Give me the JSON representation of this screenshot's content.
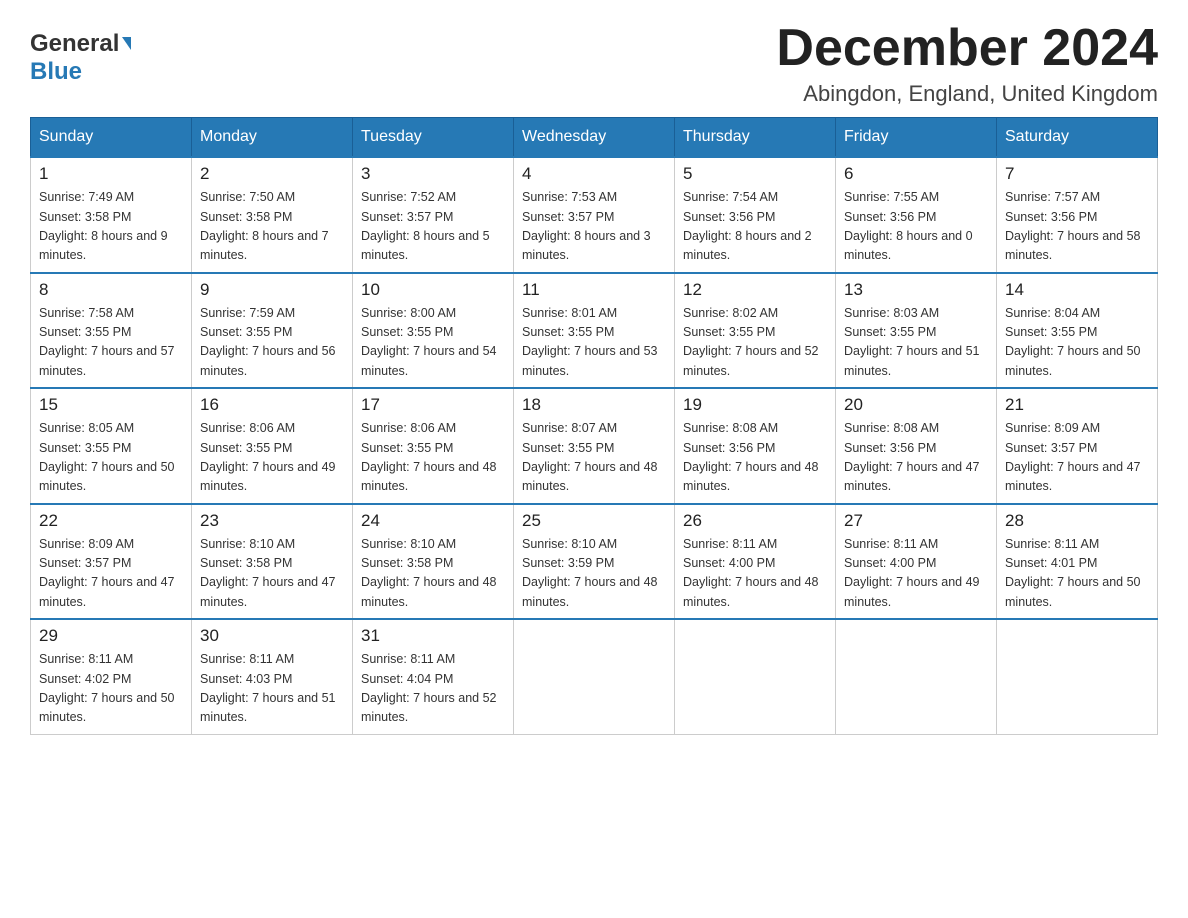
{
  "header": {
    "logo_general": "General",
    "logo_blue": "Blue",
    "month_title": "December 2024",
    "location": "Abingdon, England, United Kingdom"
  },
  "weekdays": [
    "Sunday",
    "Monday",
    "Tuesday",
    "Wednesday",
    "Thursday",
    "Friday",
    "Saturday"
  ],
  "weeks": [
    [
      {
        "day": "1",
        "sunrise": "7:49 AM",
        "sunset": "3:58 PM",
        "daylight": "8 hours and 9 minutes."
      },
      {
        "day": "2",
        "sunrise": "7:50 AM",
        "sunset": "3:58 PM",
        "daylight": "8 hours and 7 minutes."
      },
      {
        "day": "3",
        "sunrise": "7:52 AM",
        "sunset": "3:57 PM",
        "daylight": "8 hours and 5 minutes."
      },
      {
        "day": "4",
        "sunrise": "7:53 AM",
        "sunset": "3:57 PM",
        "daylight": "8 hours and 3 minutes."
      },
      {
        "day": "5",
        "sunrise": "7:54 AM",
        "sunset": "3:56 PM",
        "daylight": "8 hours and 2 minutes."
      },
      {
        "day": "6",
        "sunrise": "7:55 AM",
        "sunset": "3:56 PM",
        "daylight": "8 hours and 0 minutes."
      },
      {
        "day": "7",
        "sunrise": "7:57 AM",
        "sunset": "3:56 PM",
        "daylight": "7 hours and 58 minutes."
      }
    ],
    [
      {
        "day": "8",
        "sunrise": "7:58 AM",
        "sunset": "3:55 PM",
        "daylight": "7 hours and 57 minutes."
      },
      {
        "day": "9",
        "sunrise": "7:59 AM",
        "sunset": "3:55 PM",
        "daylight": "7 hours and 56 minutes."
      },
      {
        "day": "10",
        "sunrise": "8:00 AM",
        "sunset": "3:55 PM",
        "daylight": "7 hours and 54 minutes."
      },
      {
        "day": "11",
        "sunrise": "8:01 AM",
        "sunset": "3:55 PM",
        "daylight": "7 hours and 53 minutes."
      },
      {
        "day": "12",
        "sunrise": "8:02 AM",
        "sunset": "3:55 PM",
        "daylight": "7 hours and 52 minutes."
      },
      {
        "day": "13",
        "sunrise": "8:03 AM",
        "sunset": "3:55 PM",
        "daylight": "7 hours and 51 minutes."
      },
      {
        "day": "14",
        "sunrise": "8:04 AM",
        "sunset": "3:55 PM",
        "daylight": "7 hours and 50 minutes."
      }
    ],
    [
      {
        "day": "15",
        "sunrise": "8:05 AM",
        "sunset": "3:55 PM",
        "daylight": "7 hours and 50 minutes."
      },
      {
        "day": "16",
        "sunrise": "8:06 AM",
        "sunset": "3:55 PM",
        "daylight": "7 hours and 49 minutes."
      },
      {
        "day": "17",
        "sunrise": "8:06 AM",
        "sunset": "3:55 PM",
        "daylight": "7 hours and 48 minutes."
      },
      {
        "day": "18",
        "sunrise": "8:07 AM",
        "sunset": "3:55 PM",
        "daylight": "7 hours and 48 minutes."
      },
      {
        "day": "19",
        "sunrise": "8:08 AM",
        "sunset": "3:56 PM",
        "daylight": "7 hours and 48 minutes."
      },
      {
        "day": "20",
        "sunrise": "8:08 AM",
        "sunset": "3:56 PM",
        "daylight": "7 hours and 47 minutes."
      },
      {
        "day": "21",
        "sunrise": "8:09 AM",
        "sunset": "3:57 PM",
        "daylight": "7 hours and 47 minutes."
      }
    ],
    [
      {
        "day": "22",
        "sunrise": "8:09 AM",
        "sunset": "3:57 PM",
        "daylight": "7 hours and 47 minutes."
      },
      {
        "day": "23",
        "sunrise": "8:10 AM",
        "sunset": "3:58 PM",
        "daylight": "7 hours and 47 minutes."
      },
      {
        "day": "24",
        "sunrise": "8:10 AM",
        "sunset": "3:58 PM",
        "daylight": "7 hours and 48 minutes."
      },
      {
        "day": "25",
        "sunrise": "8:10 AM",
        "sunset": "3:59 PM",
        "daylight": "7 hours and 48 minutes."
      },
      {
        "day": "26",
        "sunrise": "8:11 AM",
        "sunset": "4:00 PM",
        "daylight": "7 hours and 48 minutes."
      },
      {
        "day": "27",
        "sunrise": "8:11 AM",
        "sunset": "4:00 PM",
        "daylight": "7 hours and 49 minutes."
      },
      {
        "day": "28",
        "sunrise": "8:11 AM",
        "sunset": "4:01 PM",
        "daylight": "7 hours and 50 minutes."
      }
    ],
    [
      {
        "day": "29",
        "sunrise": "8:11 AM",
        "sunset": "4:02 PM",
        "daylight": "7 hours and 50 minutes."
      },
      {
        "day": "30",
        "sunrise": "8:11 AM",
        "sunset": "4:03 PM",
        "daylight": "7 hours and 51 minutes."
      },
      {
        "day": "31",
        "sunrise": "8:11 AM",
        "sunset": "4:04 PM",
        "daylight": "7 hours and 52 minutes."
      },
      null,
      null,
      null,
      null
    ]
  ]
}
